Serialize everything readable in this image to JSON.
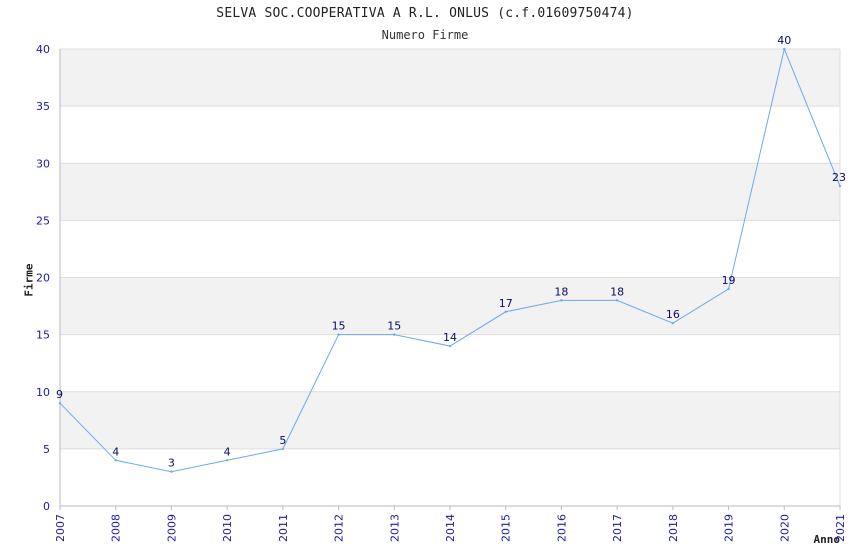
{
  "chart_data": {
    "type": "line",
    "title": "SELVA SOC.COOPERATIVA A R.L. ONLUS (c.f.01609750474)",
    "subtitle": "Numero Firme",
    "xlabel": "Anno",
    "ylabel": "Firme",
    "x": [
      "2007",
      "2008",
      "2009",
      "2010",
      "2011",
      "2012",
      "2013",
      "2014",
      "2015",
      "2016",
      "2017",
      "2018",
      "2019",
      "2020",
      "2021"
    ],
    "series": [
      {
        "values": [
          9,
          4,
          3,
          4,
          5,
          15,
          15,
          14,
          17,
          18,
          18,
          16,
          19,
          40,
          28
        ]
      }
    ],
    "data_labels": [
      "9",
      "4",
      "3",
      "4",
      "5",
      "15",
      "15",
      "14",
      "17",
      "18",
      "18",
      "16",
      "19",
      "40",
      "23"
    ],
    "ylim": [
      0,
      40
    ],
    "yticks": [
      "0",
      "5",
      "10",
      "15",
      "20",
      "25",
      "30",
      "35",
      "40"
    ],
    "grid": true,
    "banded_background": true,
    "line_color": "#6aaaf0",
    "band_color": "#f2f2f2"
  }
}
